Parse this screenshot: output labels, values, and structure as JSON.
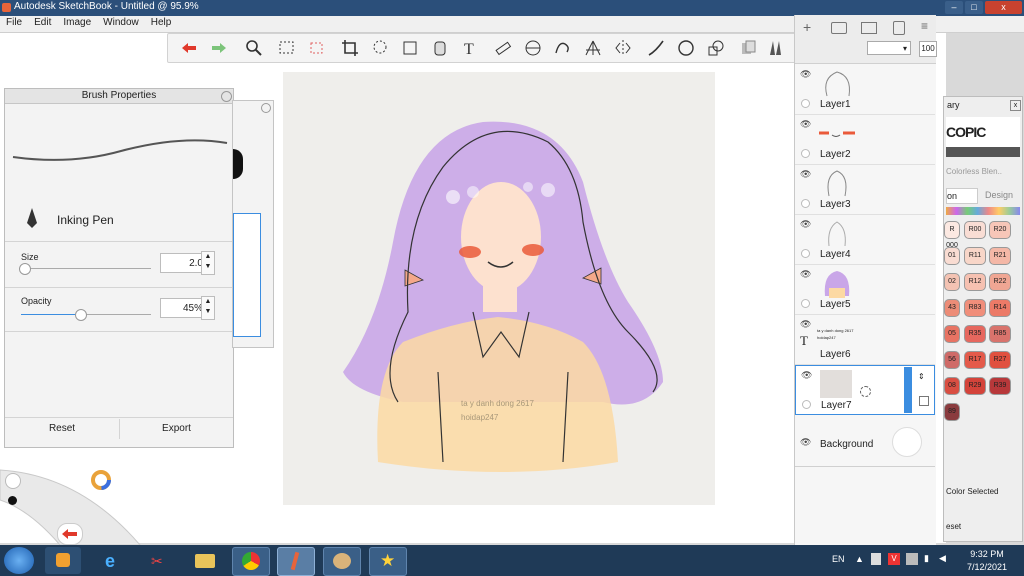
{
  "window": {
    "title": "Autodesk SketchBook - Untitled @ 95.9%",
    "controls": {
      "min": "–",
      "max": "□",
      "close": "x"
    }
  },
  "menu": [
    "File",
    "Edit",
    "Image",
    "Window",
    "Help"
  ],
  "toolbar": {
    "icons": [
      "undo-icon",
      "redo-icon",
      "zoom-icon",
      "select-rect-icon",
      "select-magic-icon",
      "crop-icon",
      "lasso-icon",
      "transform-icon",
      "bucket-icon",
      "text-icon",
      "ruler-icon",
      "ellipse-guide-icon",
      "french-curve-icon",
      "perspective-icon",
      "symmetry-icon",
      "stroke-line-icon",
      "stroke-circle-icon",
      "shapes-icon",
      "copy-paste-icon",
      "brush-library-icon",
      "color-wheel-icon",
      "swatches-icon"
    ],
    "opacity_value": "100"
  },
  "brush_panel": {
    "title": "Brush Properties",
    "brush_name": "Inking Pen",
    "size_label": "Size",
    "size_value": "2.0",
    "size_fraction": 0.02,
    "opacity_label": "Opacity",
    "opacity_value": "45%",
    "opacity_fraction": 0.45,
    "reset": "Reset",
    "export": "Export"
  },
  "canvas": {
    "watermark_line1": "ta y danh dong 2617",
    "watermark_line2": "hoidap247"
  },
  "layers": [
    {
      "name": "Layer1"
    },
    {
      "name": "Layer2"
    },
    {
      "name": "Layer3"
    },
    {
      "name": "Layer4"
    },
    {
      "name": "Layer5"
    },
    {
      "name": "Layer6",
      "text_line1": "ta y danh dong 2617",
      "text_line2": "hoidap247"
    },
    {
      "name": "Layer7"
    },
    {
      "name": "Background"
    }
  ],
  "copic": {
    "header": "ary",
    "logo": "COPIC",
    "blender": "Colorless Blen..",
    "tab1": "on",
    "tab2": "Design",
    "color_selected": "Color Selected",
    "reset": "eset",
    "swatches": [
      [
        "R00",
        "#f9ddd4"
      ],
      [
        "R20",
        "#f7c6b8"
      ],
      [
        "R11",
        "#f8d6c8"
      ],
      [
        "R21",
        "#f4b7a6"
      ],
      [
        "R12",
        "#f6c1b1"
      ],
      [
        "R22",
        "#f0a693"
      ],
      [
        "R83",
        "#f08e7a"
      ],
      [
        "R14",
        "#ec7a67"
      ],
      [
        "R35",
        "#e6675e"
      ],
      [
        "R85",
        "#d9736c"
      ],
      [
        "R17",
        "#e45a4a"
      ],
      [
        "R27",
        "#e0513f"
      ],
      [
        "R29",
        "#d4433a"
      ],
      [
        "R39",
        "#b8383a"
      ]
    ],
    "left_swatches": [
      [
        "R 000",
        "#fce9e2"
      ],
      [
        "01",
        "#f9dcd2"
      ],
      [
        "02",
        "#f4c3b3"
      ],
      [
        "43",
        "#ec8c77"
      ],
      [
        "05",
        "#e87363"
      ],
      [
        "56",
        "#cf6b68"
      ],
      [
        "08",
        "#d94e42"
      ],
      [
        "89",
        "#8a3b3e"
      ]
    ]
  },
  "taskbar": {
    "lang": "EN",
    "time": "9:32 PM",
    "date": "7/12/2021"
  },
  "colors": {
    "hair": "#c9a6e8",
    "shirt": "#fcd9a3",
    "skin": "#fde1cf",
    "blush": "#ea5a3a",
    "accent_blue": "#3b8de0"
  }
}
